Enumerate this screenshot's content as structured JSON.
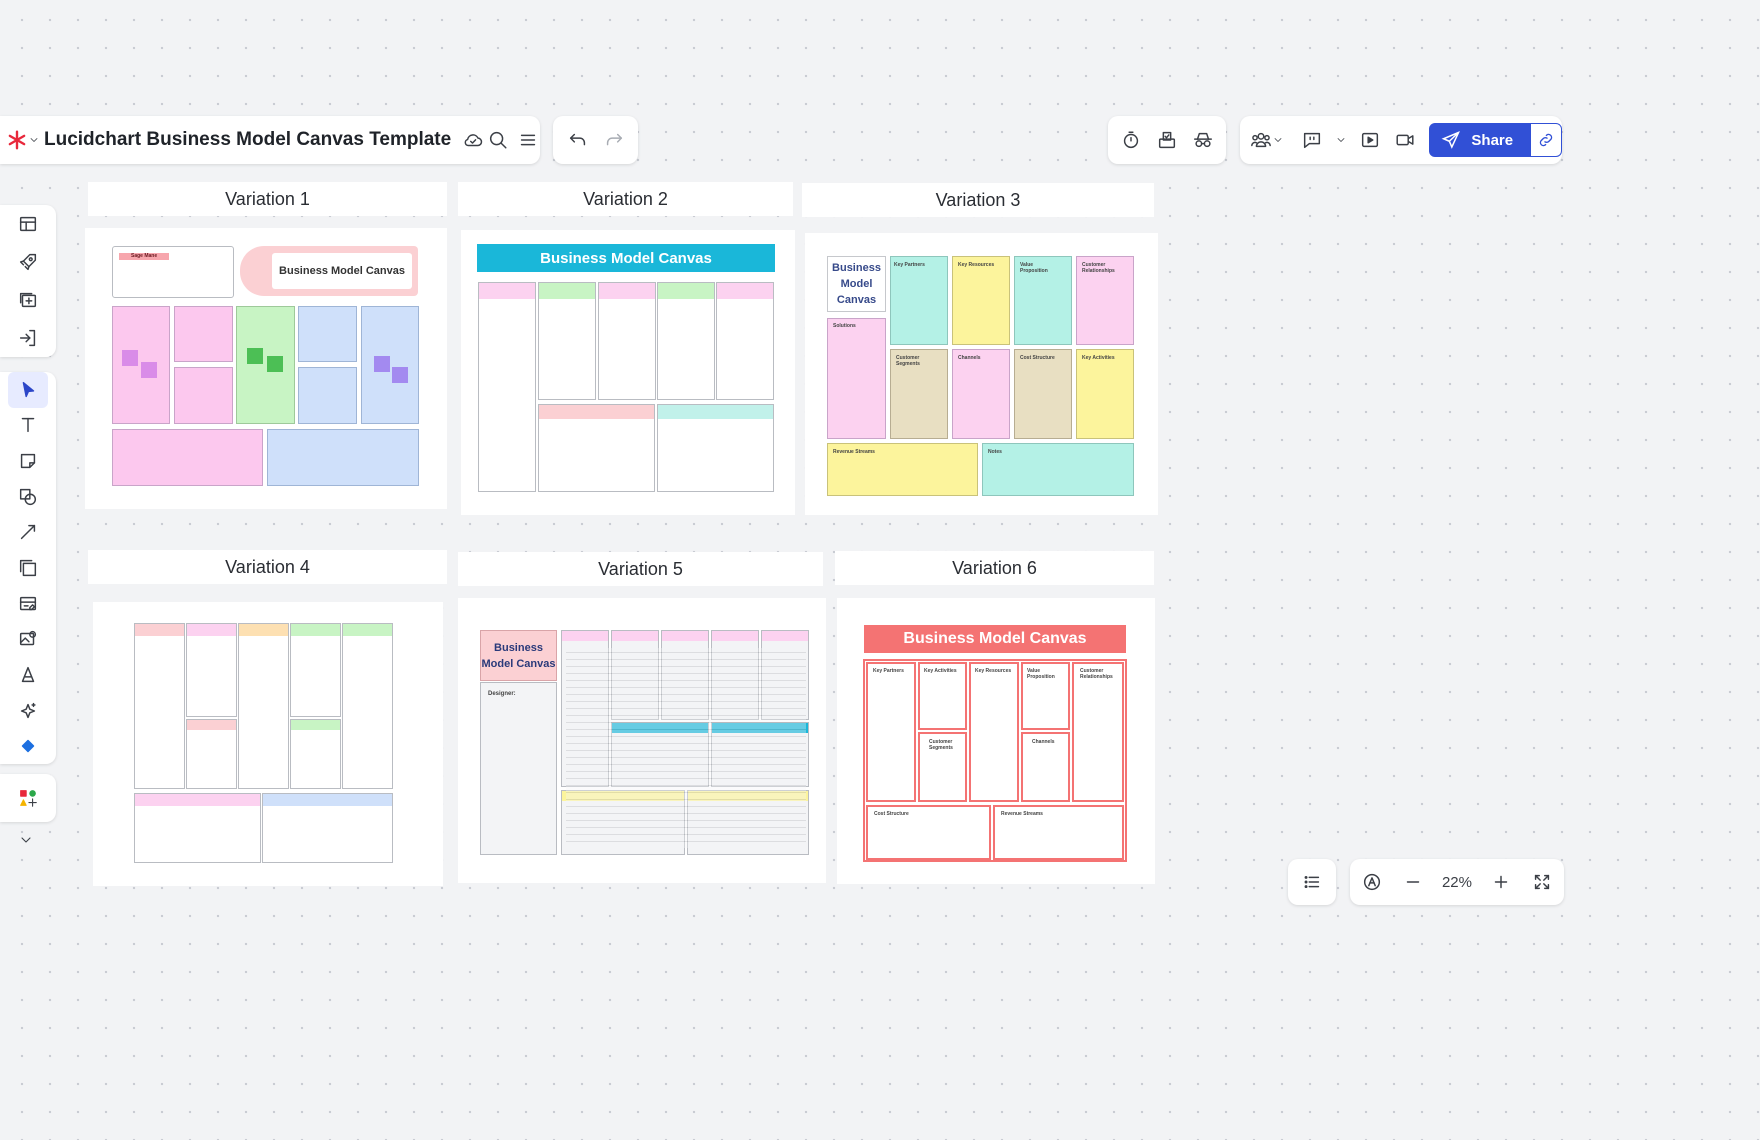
{
  "toolbar": {
    "doc_title": "Lucidchart Business Model Canvas Template",
    "share_label": "Share",
    "zoom_level": "22%"
  },
  "variations": [
    {
      "label": "Variation 1"
    },
    {
      "label": "Variation 2"
    },
    {
      "label": "Variation 3"
    },
    {
      "label": "Variation 4"
    },
    {
      "label": "Variation 5"
    },
    {
      "label": "Variation 6"
    }
  ],
  "canvases": {
    "v1": {
      "title": "Business Model Canvas",
      "tag": "Sage Mane"
    },
    "v2": {
      "title": "Business Model Canvas"
    },
    "v3": {
      "title": "Business Model Canvas",
      "cells": {
        "key_partners": "Key Partners",
        "key_resources": "Key Resources",
        "value_proposition": "Value Proposition",
        "customer_relationships": "Customer Relationships",
        "solutions": "Solutions",
        "customer_segments": "Customer Segments",
        "channels": "Channels",
        "cost_structure": "Cost Structure",
        "key_activities": "Key Activities",
        "revenue_streams": "Revenue Streams",
        "notes": "Notes"
      }
    },
    "v5": {
      "title": "Business Model Canvas",
      "designer_label": "Designer:"
    },
    "v6": {
      "title": "Business Model Canvas",
      "cells": {
        "key_partners": "Key Partners",
        "key_activities": "Key Activities",
        "key_resources": "Key Resources",
        "value_proposition": "Value Proposition",
        "customer_relationships": "Customer Relationships",
        "customer_segments": "Customer Segments",
        "channels": "Channels",
        "cost_structure": "Cost Structure",
        "revenue_streams": "Revenue Streams"
      }
    }
  },
  "colors": {
    "accent": "#3150d6",
    "brand_red": "#e8283b",
    "cyan": "#1ab7d9",
    "coral": "#f47373"
  }
}
